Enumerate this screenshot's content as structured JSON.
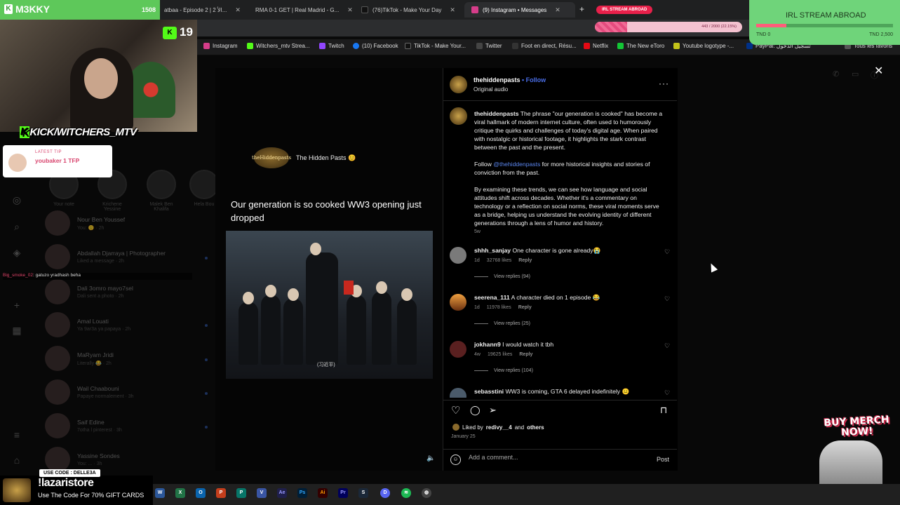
{
  "browser": {
    "tabs": [
      {
        "label": "atbaa - Episode 2 | 2 الأ...",
        "color": "#2d6bd9"
      },
      {
        "label": "RMA 0-1 GET | Real Madrid - G...",
        "color": "#2d6bd9"
      },
      {
        "label": "(76)TikTok - Make Your Day",
        "color": "#111111"
      },
      {
        "label": "(9) Instagram • Messages",
        "color": "#d63d8a"
      }
    ],
    "irl_tab": "IRL STREAM ABROAD",
    "bookmarks": [
      {
        "label": "Instagram",
        "color": "#d63d8a"
      },
      {
        "label": "Witchers_mtv Strea...",
        "color": "#53fc18"
      },
      {
        "label": "Twitch",
        "color": "#9146ff"
      },
      {
        "label": "(10) Facebook",
        "color": "#1877f2"
      },
      {
        "label": "TikTok - Make Your...",
        "color": "#111111"
      },
      {
        "label": "Twitter",
        "color": "#444444"
      },
      {
        "label": "Foot en direct, Résu...",
        "color": "#333333"
      },
      {
        "label": "Netflix",
        "color": "#e50914"
      },
      {
        "label": "The New eToro",
        "color": "#13c636"
      },
      {
        "label": "Youtube logotype -...",
        "color": "#c4c41a"
      },
      {
        "label": "PayPal: تسجيل الدخول",
        "color": "#003087"
      },
      {
        "label": "Tous les favoris",
        "color": "#555555"
      }
    ]
  },
  "stream": {
    "channel": "M3KKY",
    "channel_count": "1508",
    "kick_count": "19",
    "kick_banner": "KICK/WITCHERS_MTV",
    "latest_tip_label": "LATEST TIP",
    "latest_tip": "youbaker 1 TFP",
    "chat_user": "Big_smoke_02",
    "chat_message": ": gatuzo yradhash beha",
    "irl_goal_title": "IRL STREAM ABROAD",
    "irl_goal_left": "TND 0",
    "irl_goal_right": "TND 2,500",
    "irl_goal_fraction": 0.22,
    "pink_goal_text": "443 / 2000 (22.15%)",
    "pink_goal_fraction": 0.22,
    "merch": "BUY MERCH NOW!",
    "promo_code_label": "USE CODE : DELLE3A",
    "promo_brand": "!lazaristore",
    "promo_line": "Use The Code For 70% GIFT CARDS"
  },
  "ig_background": {
    "stories": [
      {
        "label": "Your note"
      },
      {
        "label": "Krichene Yessine"
      },
      {
        "label": "Malek Ben Khalifa"
      },
      {
        "label": "Hela Bou"
      }
    ],
    "chats": [
      {
        "name": "Nour Ben Youssef",
        "sub": "You: 🙂 · 2h"
      },
      {
        "name": "Abdallah Djarraya | Photographer",
        "sub": "Liked a message · 2h"
      },
      {
        "name": "Dali 3omro mayo7sel",
        "sub": "Dali sent a photo · 2h"
      },
      {
        "name": "Amal Louati",
        "sub": "Ya 9ar3a ya papaya · 2h"
      },
      {
        "name": "MaRyam Jridi",
        "sub": "Literally 😂 · 2h"
      },
      {
        "name": "Wail Chaabouni",
        "sub": "Papaye normalement · 3h"
      },
      {
        "name": "Saif Edine",
        "sub": "7otha l pinterest · 3h"
      },
      {
        "name": "Yassine Sondes",
        "sub": "You: ... · 3h"
      }
    ]
  },
  "post": {
    "watermark": "The Hidden Pasts 😊",
    "watermark_logo": "theHiddenpasts",
    "image_caption": "Our generation is so cooked WW3 opening just dropped",
    "video_subtitle": "(习近平)",
    "username": "thehiddenpasts",
    "follow_label": "Follow",
    "audio": "Original audio",
    "caption_p1": "The phrase \"our generation is cooked\" has become a viral hallmark of modern internet culture, often used to humorously critique the quirks and challenges of today's digital age. When paired with nostalgic or historical footage, it highlights the stark contrast between the past and the present.",
    "caption_p2_prefix": "Follow ",
    "caption_mention": "@thehiddenpasts",
    "caption_p2_suffix": " for more historical insights and stories of conviction from the past.",
    "caption_p3": "By examining these trends, we can see how language and social attitudes shift across decades. Whether it's a commentary on technology or a reflection on social norms, these viral moments serve as a bridge, helping us understand the evolving identity of different generations through a lens of humor and history.",
    "caption_time": "5w",
    "comments": [
      {
        "user": "shhh_sanjay",
        "text": "One character is gone already😭",
        "time": "1d",
        "likes": "32768 likes",
        "reply": "Reply",
        "view_replies": "View replies (94)",
        "color": "#7a7a7a"
      },
      {
        "user": "seerena_111",
        "text": "A character died on 1 episode 😂",
        "time": "1d",
        "likes": "11978 likes",
        "reply": "Reply",
        "view_replies": "View replies (25)",
        "color": "#c36a2a"
      },
      {
        "user": "jokhann9",
        "text": "I would watch it tbh",
        "time": "4w",
        "likes": "19625 likes",
        "reply": "Reply",
        "view_replies": "View replies (104)",
        "color": "#5a2020"
      },
      {
        "user": "sebasstini",
        "text": "WW3 is coming, GTA 6 delayed indefinitely 😐",
        "time": "",
        "likes": "",
        "reply": "",
        "view_replies": "",
        "color": "#4a5a6a"
      }
    ],
    "liked_by_prefix": "Liked by",
    "liked_by_user": "redivy__4",
    "liked_by_suffix": "and",
    "liked_by_others": "others",
    "date": "January 25",
    "add_comment_placeholder": "Add a comment...",
    "post_label": "Post"
  }
}
